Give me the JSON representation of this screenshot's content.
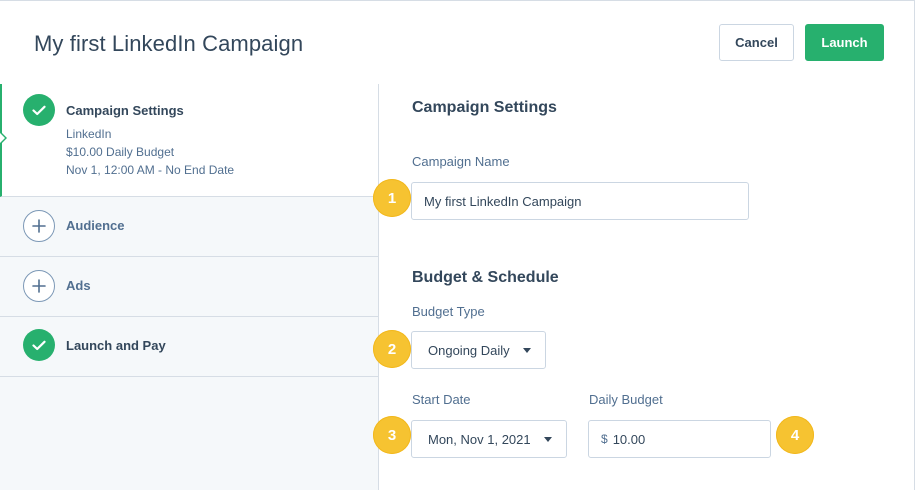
{
  "header": {
    "title": "My first LinkedIn Campaign",
    "cancel_label": "Cancel",
    "launch_label": "Launch"
  },
  "sidebar": {
    "steps": [
      {
        "label": "Campaign Settings",
        "status": "complete",
        "details": [
          "LinkedIn",
          "$10.00 Daily Budget",
          "Nov 1, 12:00 AM - No End Date"
        ]
      },
      {
        "label": "Audience",
        "status": "incomplete"
      },
      {
        "label": "Ads",
        "status": "incomplete"
      },
      {
        "label": "Launch and Pay",
        "status": "complete"
      }
    ]
  },
  "main": {
    "campaign_settings_title": "Campaign Settings",
    "campaign_name_label": "Campaign Name",
    "campaign_name_value": "My first LinkedIn Campaign",
    "budget_schedule_title": "Budget & Schedule",
    "budget_type_label": "Budget Type",
    "budget_type_value": "Ongoing Daily",
    "start_date_label": "Start Date",
    "start_date_value": "Mon, Nov 1, 2021",
    "daily_budget_label": "Daily Budget",
    "currency_symbol": "$",
    "daily_budget_value": "10.00"
  },
  "badges": [
    "1",
    "2",
    "3",
    "4"
  ],
  "colors": {
    "accent_green": "#27b06e",
    "badge_yellow": "#f6c331",
    "text_dark": "#33475b",
    "sidebar_bg": "#f5f8fa"
  },
  "icons": {
    "complete": "check-icon",
    "incomplete": "plus-icon"
  }
}
